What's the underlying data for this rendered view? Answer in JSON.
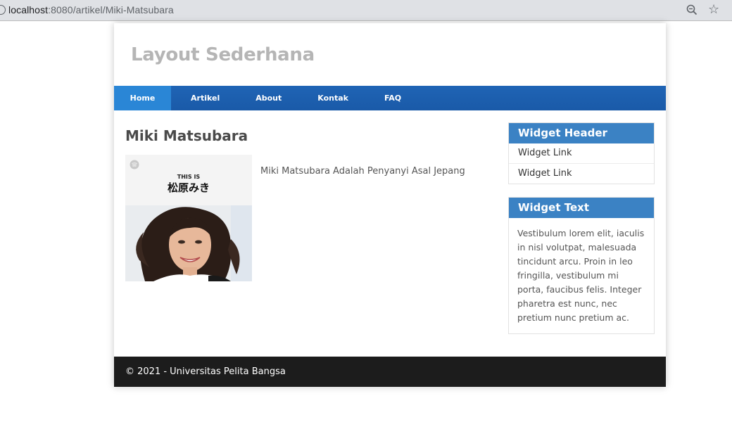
{
  "browser": {
    "url_host": "localhost",
    "url_path": ":8080/artikel/Miki-Matsubara"
  },
  "site": {
    "title": "Layout Sederhana"
  },
  "nav": {
    "items": [
      {
        "label": "Home",
        "active": true
      },
      {
        "label": "Artikel"
      },
      {
        "label": "About"
      },
      {
        "label": "Kontak"
      },
      {
        "label": "FAQ"
      }
    ]
  },
  "article": {
    "title": "Miki Matsubara",
    "body": "Miki Matsubara Adalah Penyanyi Asal Jepang",
    "image": {
      "caption_top": "THIS IS",
      "caption_name": "松原みき"
    }
  },
  "widgets": {
    "links": {
      "header": "Widget Header",
      "items": [
        "Widget Link",
        "Widget Link"
      ]
    },
    "text": {
      "header": "Widget Text",
      "body": "Vestibulum lorem elit, iaculis in nisl volutpat, malesuada tincidunt arcu. Proin in leo fringilla, vestibulum mi porta, faucibus felis. Integer pharetra est nunc, nec pretium nunc pretium ac."
    }
  },
  "footer": {
    "text": "© 2021 - Universitas Pelita Bangsa"
  },
  "colors": {
    "nav_bg": "#1f64b5",
    "nav_active": "#2a86d6",
    "widget_header": "#3b82c4",
    "footer_bg": "#1c1c1c",
    "title_gray": "#b5b5b5"
  }
}
